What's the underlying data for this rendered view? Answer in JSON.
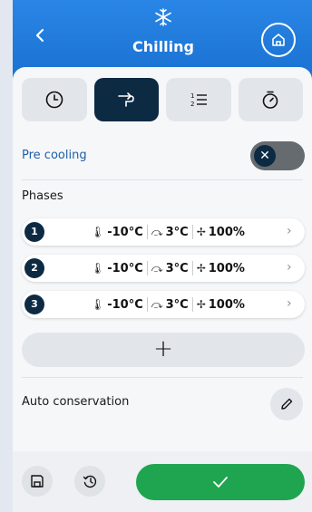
{
  "header": {
    "title": "Chilling",
    "icons": {
      "back": "chevron-left-icon",
      "mode": "snowflake-icon",
      "home": "home-icon"
    }
  },
  "tabs": [
    {
      "name": "time",
      "icon": "clock-icon",
      "active": false
    },
    {
      "name": "probe",
      "icon": "probe-icon",
      "active": true
    },
    {
      "name": "phases-list",
      "icon": "numbered-list-icon",
      "active": false
    },
    {
      "name": "timer",
      "icon": "stopwatch-icon",
      "active": false
    }
  ],
  "precooling": {
    "label": "Pre cooling",
    "enabled": false
  },
  "phases": {
    "label": "Phases",
    "items": [
      {
        "num": "1",
        "air_temp": "-10°C",
        "core_temp": "3°C",
        "fan": "100%"
      },
      {
        "num": "2",
        "air_temp": "-10°C",
        "core_temp": "3°C",
        "fan": "100%"
      },
      {
        "num": "3",
        "air_temp": "-10°C",
        "core_temp": "3°C",
        "fan": "100%"
      }
    ],
    "add_label": "+"
  },
  "auto_conservation": {
    "label": "Auto conservation"
  },
  "colors": {
    "header_blue": "#1e78d8",
    "dark_navy": "#0d2a43",
    "confirm_green": "#1fa54f",
    "label_blue": "#1e5fa8"
  }
}
